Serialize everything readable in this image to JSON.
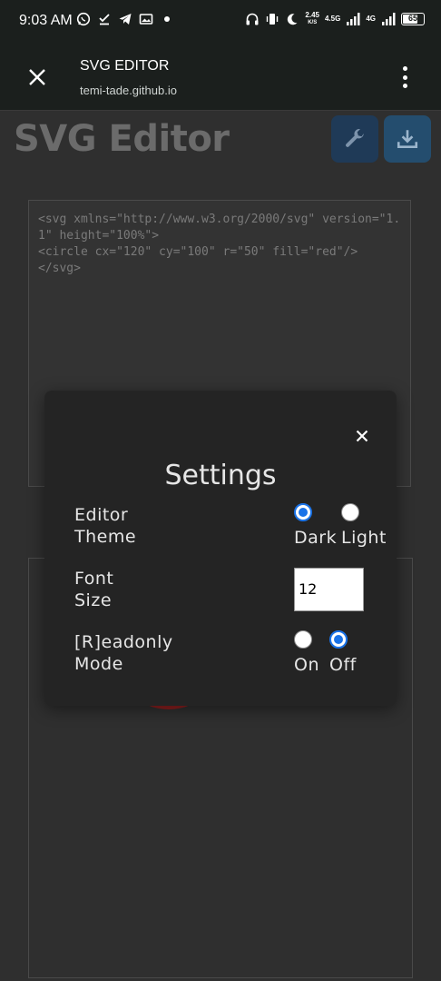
{
  "status_bar": {
    "time": "9:03 AM",
    "speed_value": "2.45",
    "speed_unit": "K/S",
    "net1": "4.5G",
    "net2": "4G",
    "battery": "65",
    "left_icons": [
      "whatsapp-icon",
      "download-done-icon",
      "telegram-icon",
      "image-icon",
      "dot-icon"
    ],
    "right_icons": [
      "headphones-icon",
      "vibrate-icon",
      "moon-icon",
      "signal-icon",
      "signal-icon",
      "battery-icon"
    ]
  },
  "toolbar": {
    "title": "SVG EDITOR",
    "url": "temi-tade.github.io",
    "close_icon": "close-icon",
    "menu_icon": "more-vert-icon"
  },
  "page": {
    "title": "SVG Editor",
    "settings_icon": "wrench-icon",
    "download_icon": "download-icon",
    "code": "<svg xmlns=\"http://www.w3.org/2000/svg\" version=\"1.1\" height=\"100%\">\n<circle cx=\"120\" cy=\"100\" r=\"50\" fill=\"red\"/>\n</svg>",
    "preview_circle_color": "#8a1e1e"
  },
  "settings_modal": {
    "title": "Settings",
    "close_symbol": "×",
    "editor_theme": {
      "label_line1": "Editor",
      "label_line2": "Theme",
      "options": [
        "Dark",
        "Light"
      ],
      "selected": "Dark"
    },
    "font_size": {
      "label_line1": "Font",
      "label_line2": "Size",
      "value": "12"
    },
    "readonly_mode": {
      "label_line1": "[R]eadonly",
      "label_line2": "Mode",
      "options": [
        "On",
        "Off"
      ],
      "selected": "Off"
    }
  },
  "colors": {
    "accent": "#1a73e8",
    "background": "#2f2f2f",
    "modal": "#242424",
    "toolbar": "#1b1f1d"
  }
}
